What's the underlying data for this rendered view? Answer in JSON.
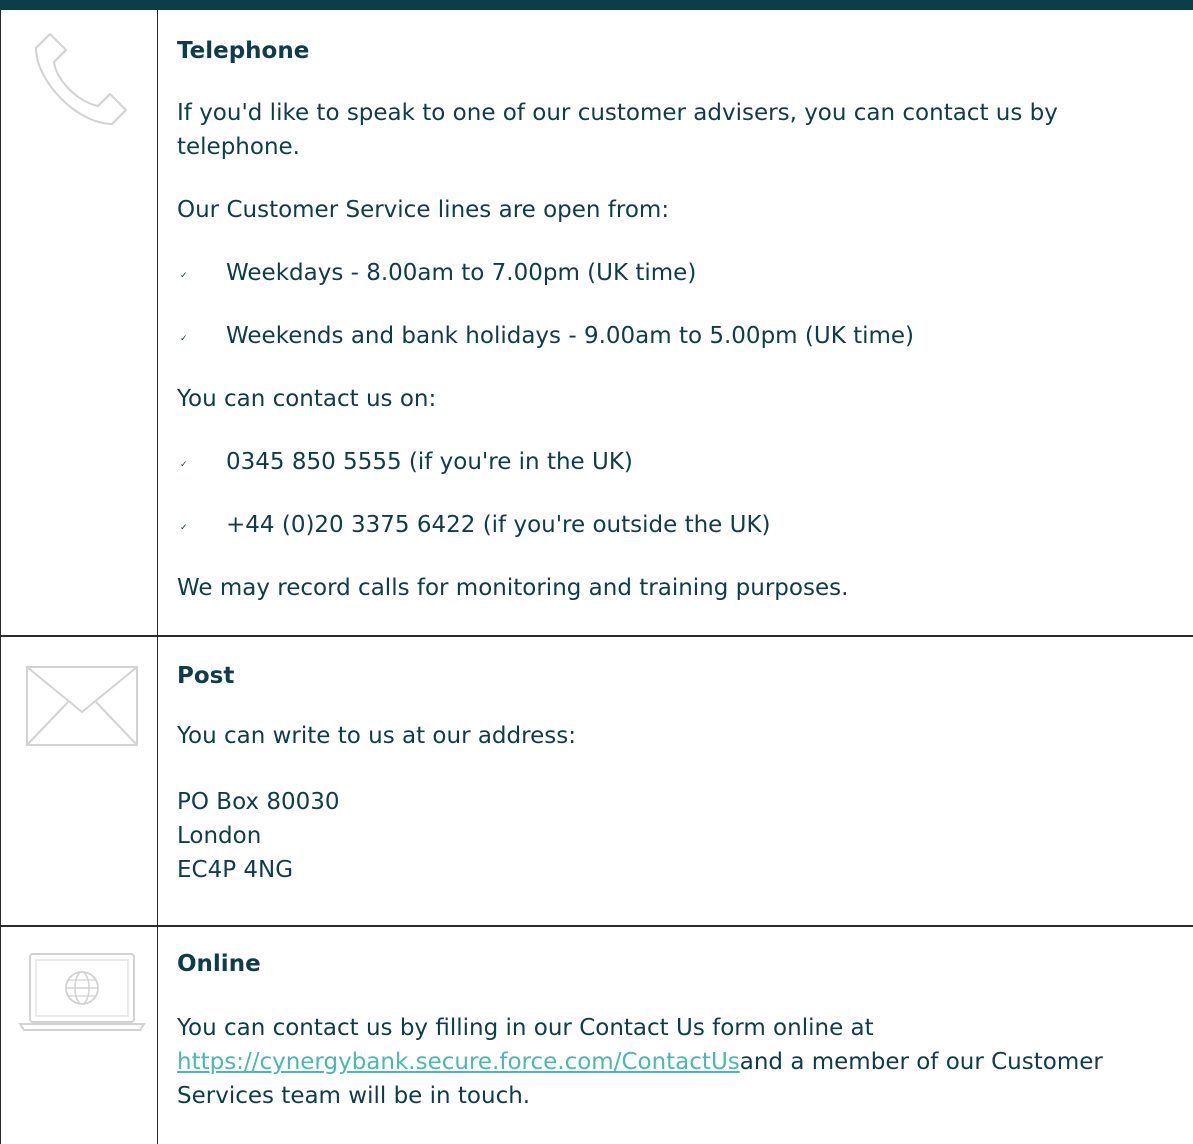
{
  "sections": {
    "telephone": {
      "icon": "telephone-icon",
      "title": "Telephone",
      "intro": "If you'd like to speak to one of our customer advisers, you can contact us by telephone.",
      "hours_intro": "Our Customer Service lines are open from:",
      "hours": [
        "Weekdays - 8.00am to 7.00pm (UK time)",
        "Weekends and bank holidays - 9.00am to 5.00pm (UK time)"
      ],
      "numbers_intro": "You can contact us on:",
      "numbers": [
        "0345 850 5555 (if you're in the UK)",
        "+44 (0)20 3375 6422 (if you're outside the UK)"
      ],
      "note": "We may record calls for monitoring and training purposes."
    },
    "post": {
      "icon": "envelope-icon",
      "title": "Post",
      "intro": "You can write to us at our address:",
      "address": [
        "PO Box 80030",
        "London",
        "EC4P 4NG"
      ]
    },
    "online": {
      "icon": "laptop-globe-icon",
      "title": "Online",
      "text_before": "You can contact us by filling in our Contact Us form online at",
      "link": "https://cynergybank.secure.force.com/ContactUs",
      "text_after": "and a member of our Customer Services team will be in touch."
    }
  },
  "colors": {
    "heading": "#0d3c4a",
    "text": "#0d3c4a",
    "link": "#49b8b2",
    "border": "#2a2a2a",
    "topbar": "#0d3d4b"
  }
}
